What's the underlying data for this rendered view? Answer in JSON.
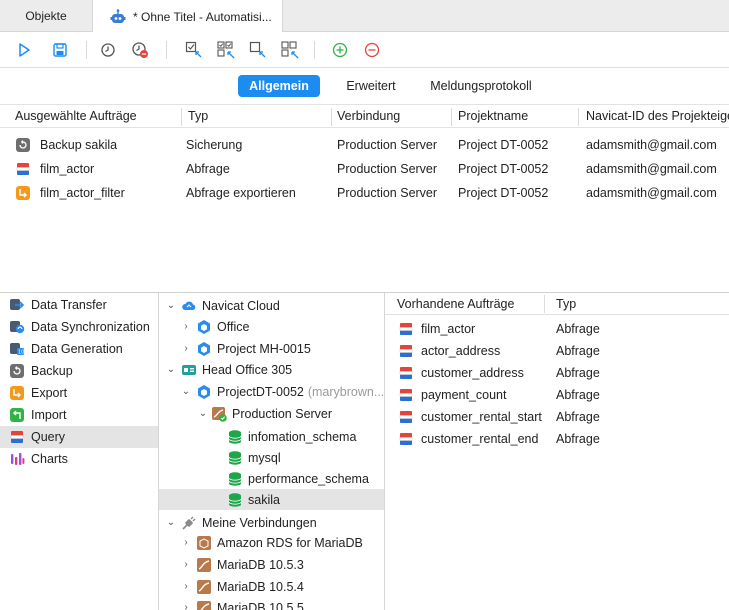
{
  "tabs": {
    "objects": "Objekte",
    "active": "* Ohne Titel - Automatisi..."
  },
  "toolbar": {
    "icons": [
      "run-icon",
      "save-icon",
      "schedule-icon",
      "delete-schedule-icon",
      "select-icon",
      "select-all-icon",
      "deselect-icon",
      "deselect-all-icon",
      "add-icon",
      "remove-icon"
    ]
  },
  "segments": {
    "general": "Allgemein",
    "advanced": "Erweitert",
    "log": "Meldungsprotokoll"
  },
  "jobs_table": {
    "columns": [
      "Ausgewählte Aufträge",
      "Typ",
      "Verbindung",
      "Projektname",
      "Navicat-ID des Projekteigentümers"
    ],
    "rows": [
      {
        "icon": "backup-icon",
        "name": "Backup sakila",
        "type": "Sicherung",
        "connection": "Production Server",
        "project": "Project DT-0052",
        "owner": "adamsmith@gmail.com"
      },
      {
        "icon": "query-icon",
        "name": "film_actor",
        "type": "Abfrage",
        "connection": "Production Server",
        "project": "Project DT-0052",
        "owner": "adamsmith@gmail.com"
      },
      {
        "icon": "export-icon",
        "name": "film_actor_filter",
        "type": "Abfrage exportieren",
        "connection": "Production Server",
        "project": "Project DT-0052",
        "owner": "adamsmith@gmail.com"
      }
    ]
  },
  "left_menu": [
    {
      "label": "Data Transfer",
      "icon": "data-transfer-icon"
    },
    {
      "label": "Data Synchronization",
      "icon": "data-sync-icon"
    },
    {
      "label": "Data Generation",
      "icon": "data-generation-icon"
    },
    {
      "label": "Backup",
      "icon": "backup-icon"
    },
    {
      "label": "Export",
      "icon": "export-icon"
    },
    {
      "label": "Import",
      "icon": "import-icon"
    },
    {
      "label": "Query",
      "icon": "query-icon",
      "selected": true
    },
    {
      "label": "Charts",
      "icon": "charts-icon"
    }
  ],
  "tree": {
    "navicat_cloud": "Navicat Cloud",
    "office": "Office",
    "project_mh": "Project MH-0015",
    "head_office": "Head Office 305",
    "project_dt": "ProjectDT-0052",
    "project_dt_owner": "(marybrown...",
    "production_server": "Production Server",
    "db1": "infomation_schema",
    "db2": "mysql",
    "db3": "performance_schema",
    "db4": "sakila",
    "my_connections": "Meine Verbindungen",
    "conn1": "Amazon RDS for MariaDB",
    "conn2": "MariaDB 10.5.3",
    "conn3": "MariaDB 10.5.4",
    "conn4": "MariaDB 10.5.5"
  },
  "available": {
    "columns": [
      "Vorhandene Aufträge",
      "Typ"
    ],
    "rows": [
      {
        "name": "film_actor",
        "type": "Abfrage"
      },
      {
        "name": "actor_address",
        "type": "Abfrage"
      },
      {
        "name": "customer_address",
        "type": "Abfrage"
      },
      {
        "name": "payment_count",
        "type": "Abfrage"
      },
      {
        "name": "customer_rental_start",
        "type": "Abfrage"
      },
      {
        "name": "customer_rental_end",
        "type": "Abfrage"
      }
    ]
  },
  "colors": {
    "accent": "#1c8cf0",
    "add": "#2fb344",
    "remove": "#e2453c",
    "db_green": "#1fa64a"
  }
}
